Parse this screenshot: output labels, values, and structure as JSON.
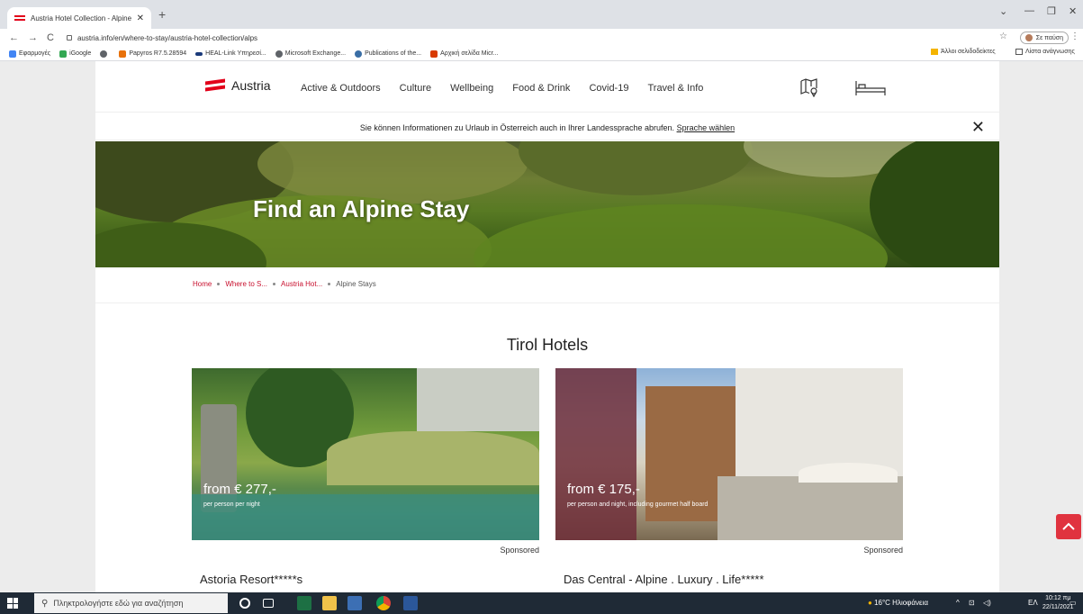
{
  "browser": {
    "tab_title": "Austria Hotel Collection - Alpine",
    "tab_close": "✕",
    "new_tab": "+",
    "url": "austria.info/en/where-to-stay/austria-hotel-collection/alps",
    "profile_label": "Σε παύση",
    "bookmarks": [
      {
        "label": "Εφαρμογές",
        "color": "#f4b400"
      },
      {
        "label": "iGoogle",
        "color": "#4285f4"
      },
      {
        "label": "",
        "color": "#5f6368"
      },
      {
        "label": "Papyros R7.5.28594",
        "color": "#e8710a"
      },
      {
        "label": "HEAL-Link Υπηρεσί...",
        "color": "#1a3a7a"
      },
      {
        "label": "Microsoft Exchange...",
        "color": "#5f6368"
      },
      {
        "label": "Publications of the...",
        "color": "#3a6ea5"
      },
      {
        "label": "Αρχική σελίδα Micr...",
        "color": "#d83b01"
      }
    ],
    "other_bookmarks": "Άλλοι σελιδοδείκτες",
    "reading_list": "Λίστα ανάγνωσης"
  },
  "site": {
    "logo_text": "Austria",
    "menu": [
      "Active & Outdoors",
      "Culture",
      "Wellbeing",
      "Food & Drink",
      "Covid-19",
      "Travel & Info"
    ],
    "lang_banner_text": "Sie können Informationen zu Urlaub in Österreich auch in Ihrer Landessprache abrufen.",
    "lang_banner_link": "Sprache wählen",
    "lang_close": "✕",
    "hero_title": "Find an Alpine Stay",
    "breadcrumb": [
      "Home",
      "Where to S...",
      "Austria Hot...",
      "Alpine Stays"
    ],
    "section_title": "Tirol Hotels",
    "cards": [
      {
        "price": "from € 277,-",
        "price_sub": "per person per night",
        "sponsored": "Sponsored",
        "name": "Astoria Resort*****s"
      },
      {
        "price": "from € 175,-",
        "price_sub": "per person and night, including gourmet half board",
        "sponsored": "Sponsored",
        "name": "Das Central - Alpine . Luxury . Life*****"
      }
    ]
  },
  "taskbar": {
    "search_placeholder": "Πληκτρολογήστε εδώ για αναζήτηση",
    "weather": "16°C Ηλιοφάνεια",
    "lang": "ΕΛ",
    "time": "10:12 πμ",
    "date": "22/11/2021"
  },
  "colors": {
    "accent": "#e2001a",
    "link": "#c8102e",
    "taskbar": "#1f2a36"
  }
}
